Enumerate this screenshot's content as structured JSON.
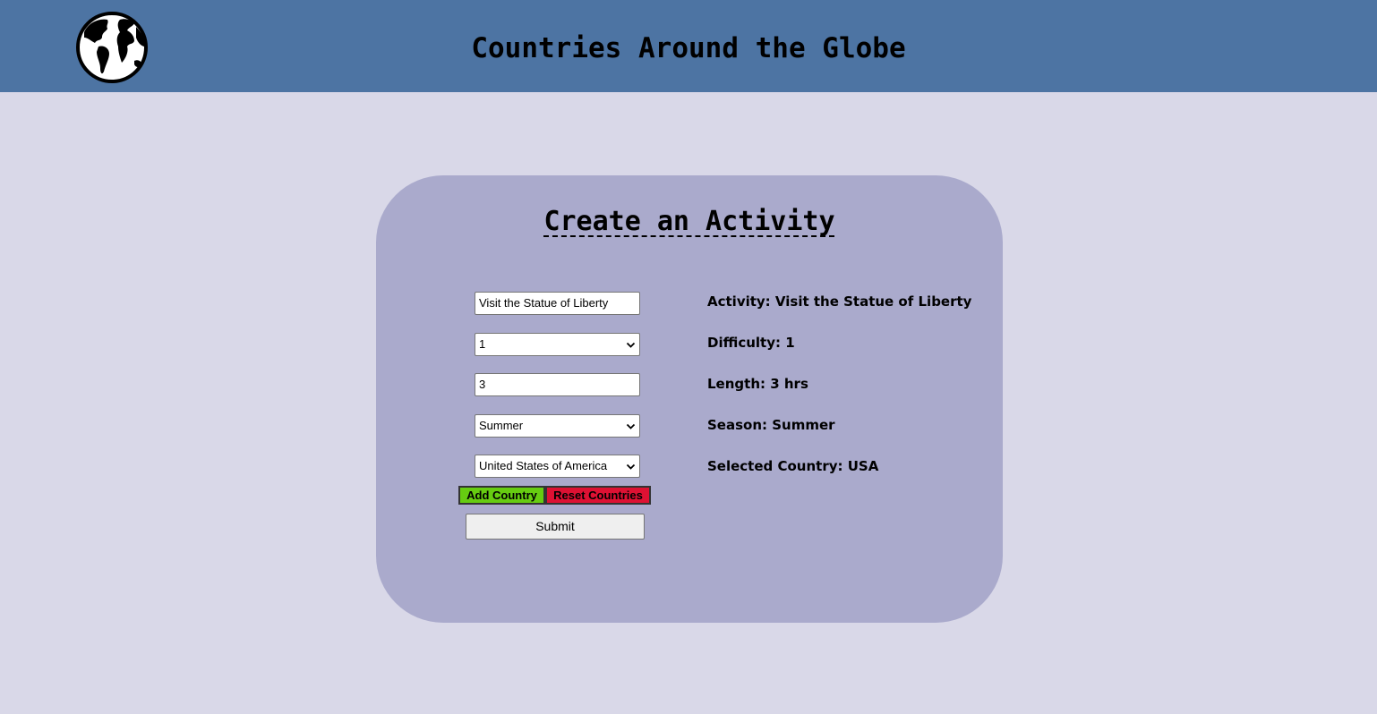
{
  "header": {
    "title": "Countries Around the Globe",
    "logo_icon": "globe-icon"
  },
  "form": {
    "heading": "Create an Activity",
    "activity_name_value": "Visit the Statue of Liberty",
    "difficulty_value": "1",
    "length_value": "3",
    "season_value": "Summer",
    "country_value": "United States of America",
    "add_country_label": "Add Country",
    "reset_countries_label": "Reset Countries",
    "submit_label": "Submit"
  },
  "summary": {
    "activity": "Activity: Visit the Statue of Liberty",
    "difficulty": "Difficulty: 1",
    "length": "Length: 3 hrs",
    "season": "Season: Summer",
    "selected_country": "Selected Country: USA"
  },
  "colors": {
    "header_bg": "#4d74a3",
    "page_bg": "#d9d8e8",
    "card_bg": "#aaaacc",
    "add_button": "#66cc11",
    "reset_button": "#dd1133"
  }
}
